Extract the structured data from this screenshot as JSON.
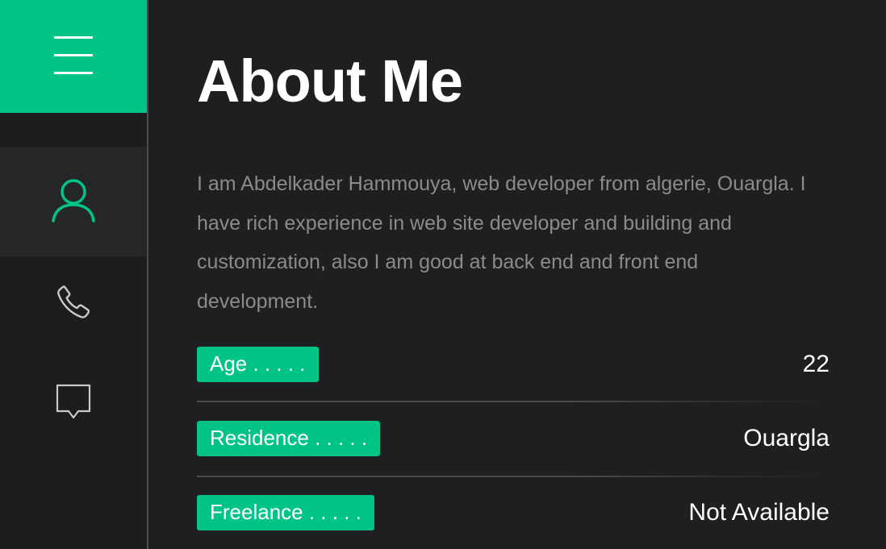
{
  "sidebar": {
    "menu_icon": "hamburger-menu-icon",
    "items": [
      {
        "icon": "user-icon",
        "active": true
      },
      {
        "icon": "phone-icon",
        "active": false
      },
      {
        "icon": "chat-bubble-icon",
        "active": false
      }
    ],
    "accent_color": "#00c486"
  },
  "main": {
    "title": "About Me",
    "bio": "I am Abdelkader Hammouya, web developer from algerie, Ouargla. I have rich experience in web site developer and building and customization, also I am good at back end and front end development.",
    "info": [
      {
        "label": "Age . . . . .",
        "value": "22"
      },
      {
        "label": "Residence . . . . .",
        "value": "Ouargla"
      },
      {
        "label": "Freelance . . . . .",
        "value": "Not Available"
      }
    ]
  }
}
